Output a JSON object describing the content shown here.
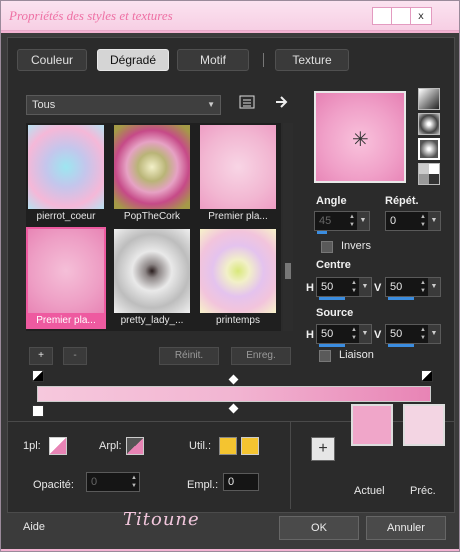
{
  "window": {
    "title": "Propriétés des styles et textures",
    "close_label": "x"
  },
  "tabs": [
    {
      "label": "Couleur"
    },
    {
      "label": "Dégradé",
      "active": true
    },
    {
      "label": "Motif"
    },
    {
      "label": "Texture"
    }
  ],
  "gradient_list": {
    "category": "Tous",
    "items": [
      {
        "label": "pierrot_coeur"
      },
      {
        "label": "PopTheCork"
      },
      {
        "label": "Premier pla..."
      },
      {
        "label": "Premier pla...",
        "selected": true
      },
      {
        "label": "pretty_lady_..."
      },
      {
        "label": "printemps"
      }
    ]
  },
  "gallery_buttons": {
    "add": "+",
    "remove": "-",
    "reset": "Réinit.",
    "save": "Enreg."
  },
  "settings": {
    "angle_label": "Angle",
    "angle_value": "45",
    "repeat_label": "Répét.",
    "repeat_value": "0",
    "invert_label": "Invers",
    "center_label": "Centre",
    "center_h_label": "H",
    "center_h": "50",
    "center_v_label": "V",
    "center_v": "50",
    "source_label": "Source",
    "source_h_label": "H",
    "source_h": "50",
    "source_v_label": "V",
    "source_v": "50",
    "link_label": "Liaison"
  },
  "stops": {
    "first_label": "1pl:",
    "back_label": "Arpl:",
    "use_label": "Util.:",
    "opacity_label": "Opacité:",
    "opacity_value": "0",
    "location_label": "Empl.:",
    "location_value": "0"
  },
  "colors": {
    "current_label": "Actuel",
    "previous_label": "Préc.",
    "current": "#f0a6c9",
    "previous": "#f3d5e3",
    "accent": "#ee5aa0",
    "use_swatch": "#f4c430"
  },
  "footer": {
    "help": "Aide",
    "ok": "OK",
    "cancel": "Annuler",
    "signature": "Titoune"
  }
}
